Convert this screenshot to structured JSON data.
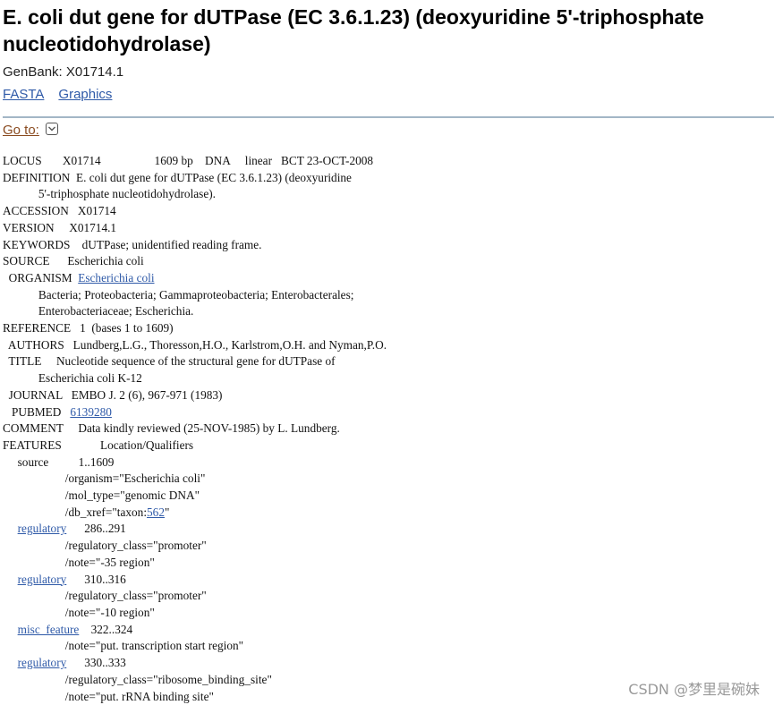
{
  "page": {
    "title": "E. coli dut gene for dUTPase (EC 3.6.1.23) (deoxyuridine 5'-triphosphate nucleotidohydrolase)",
    "accession_line": "GenBank: X01714.1",
    "links": [
      "FASTA",
      "Graphics"
    ],
    "goto_label": "Go to:"
  },
  "record": {
    "locus": "LOCUS       X01714                  1609 bp    DNA     linear   BCT 23-OCT-2008",
    "definition_1": "DEFINITION  E. coli dut gene for dUTPase (EC 3.6.1.23) (deoxyuridine",
    "definition_2": "            5'-triphosphate nucleotidohydrolase).",
    "accession": "ACCESSION   X01714",
    "version": "VERSION     X01714.1",
    "keywords": "KEYWORDS    dUTPase; unidentified reading frame.",
    "source": "SOURCE      Escherichia coli",
    "organism_prefix": "  ORGANISM  ",
    "organism_link": "Escherichia coli",
    "lineage_1": "            Bacteria; Proteobacteria; Gammaproteobacteria; Enterobacterales;",
    "lineage_2": "            Enterobacteriaceae; Escherichia.",
    "reference": "REFERENCE   1  (bases 1 to 1609)",
    "authors": "  AUTHORS   Lundberg,L.G., Thoresson,H.O., Karlstrom,O.H. and Nyman,P.O.",
    "title_1": "  TITLE     Nucleotide sequence of the structural gene for dUTPase of",
    "title_2": "            Escherichia coli K-12",
    "journal": "  JOURNAL   EMBO J. 2 (6), 967-971 (1983)",
    "pubmed_prefix": "   PUBMED   ",
    "pubmed_link": "6139280",
    "comment": "COMMENT     Data kindly reviewed (25-NOV-1985) by L. Lundberg.",
    "features": "FEATURES             Location/Qualifiers",
    "source_feature": "     source          1..1609",
    "source_q1": "                     /organism=\"Escherichia coli\"",
    "source_q2": "                     /mol_type=\"genomic DNA\"",
    "source_q3_prefix": "                     /db_xref=\"taxon:",
    "taxon_link": "562",
    "source_q3_suffix": "\"",
    "indent": "     ",
    "reg1_name": "regulatory",
    "reg1_loc": "      286..291",
    "reg1_q1": "                     /regulatory_class=\"promoter\"",
    "reg1_q2": "                     /note=\"-35 region\"",
    "reg2_name": "regulatory",
    "reg2_loc": "      310..316",
    "reg2_q1": "                     /regulatory_class=\"promoter\"",
    "reg2_q2": "                     /note=\"-10 region\"",
    "misc_name": "misc_feature",
    "misc_loc": "    322..324",
    "misc_q1": "                     /note=\"put. transcription start region\"",
    "reg3_name": "regulatory",
    "reg3_loc": "      330..333",
    "reg3_q1": "                     /regulatory_class=\"ribosome_binding_site\"",
    "reg3_q2": "                     /note=\"put. rRNA binding site\""
  },
  "watermark": "CSDN @梦里是碗妹"
}
